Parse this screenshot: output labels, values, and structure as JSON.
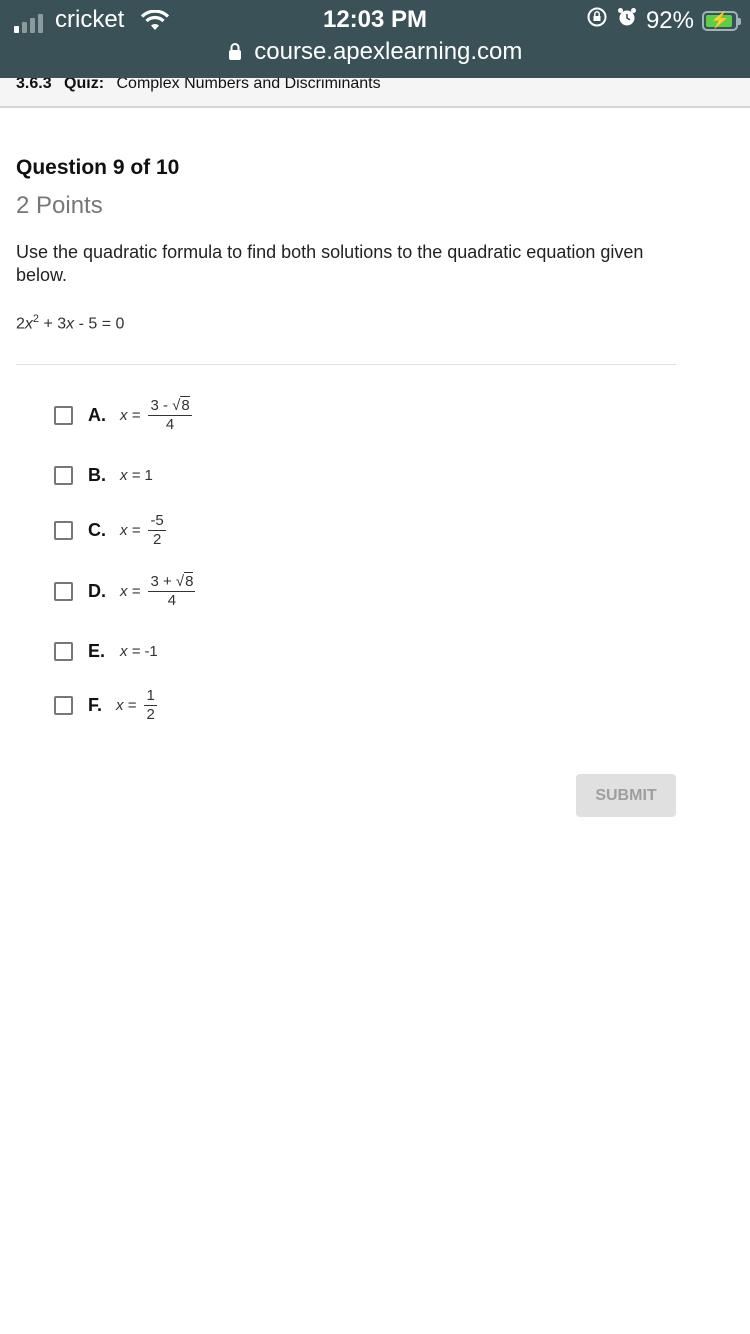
{
  "status_bar": {
    "carrier": "cricket",
    "time": "12:03 PM",
    "battery": "92%",
    "battery_level": 0.92,
    "url": "course.apexlearning.com",
    "icons": [
      "signal-icon",
      "wifi-icon",
      "orientation-lock-icon",
      "alarm-icon",
      "battery-charging-icon",
      "lock-icon"
    ]
  },
  "quiz_header": {
    "number": "3.6.3",
    "label": "Quiz:",
    "title": "Complex Numbers and Discriminants"
  },
  "question": {
    "title": "Question 9 of 10",
    "points": "2 Points",
    "prompt": "Use the quadratic formula to find both solutions to the quadratic equation given below.",
    "equation": {
      "coef_a": "2",
      "var": "x",
      "exp": "2",
      "rest": " + 3",
      "var2": "x",
      "tail": " - 5 = 0"
    }
  },
  "options": [
    {
      "letter": "A.",
      "lhs": "x =",
      "numerator_pre": "3 - ",
      "radicand": "8",
      "denominator": "4",
      "checked": false
    },
    {
      "letter": "B.",
      "lhs": "x =",
      "value": "1",
      "checked": false
    },
    {
      "letter": "C.",
      "lhs": "x =",
      "numerator": "-5",
      "denominator": "2",
      "checked": false
    },
    {
      "letter": "D.",
      "lhs": "x =",
      "numerator_pre": "3 + ",
      "radicand": "8",
      "denominator": "4",
      "checked": false
    },
    {
      "letter": "E.",
      "lhs": "x =",
      "value": "-1",
      "checked": false
    },
    {
      "letter": "F.",
      "lhs": "x =",
      "numerator": "1",
      "denominator": "2",
      "checked": false
    }
  ],
  "submit_label": "SUBMIT"
}
